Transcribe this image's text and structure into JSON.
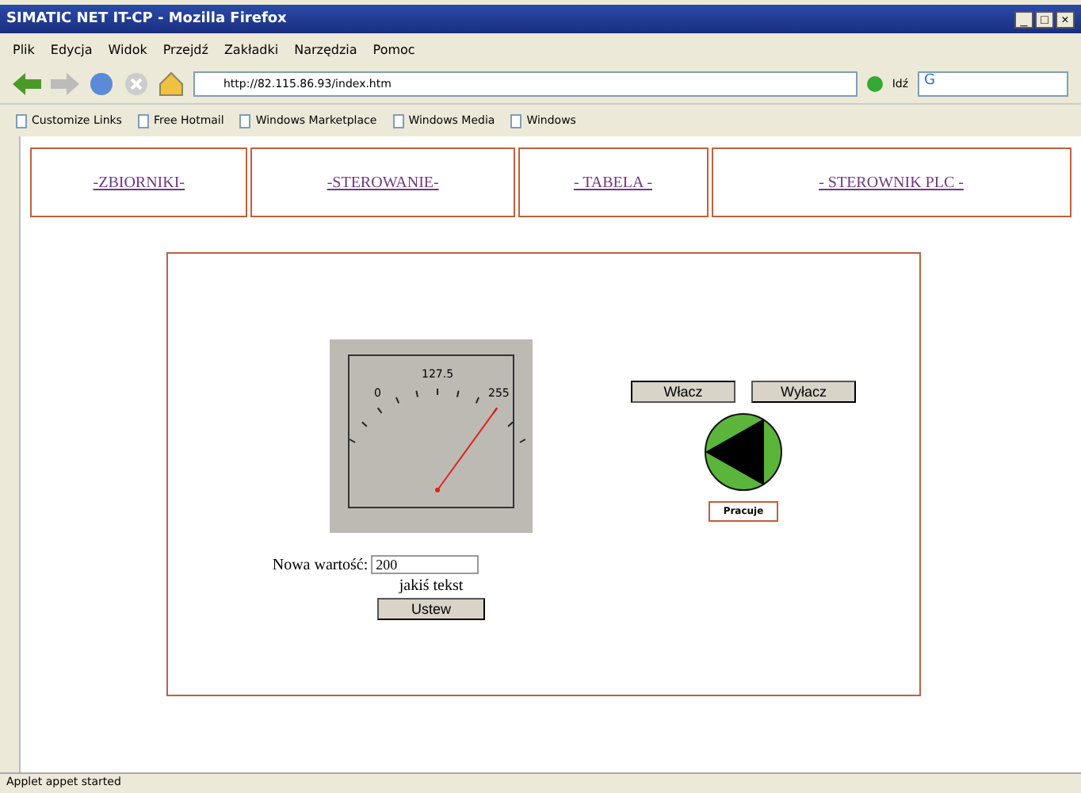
{
  "window": {
    "title": "SIMATIC NET IT-CP - Mozilla Firefox",
    "controls": [
      "_",
      "□",
      "×"
    ]
  },
  "menu": [
    "Plik",
    "Edycja",
    "Widok",
    "Przejdź",
    "Zakładki",
    "Narzędzia",
    "Pomoc"
  ],
  "address": {
    "url": "http://82.115.86.93/index.htm",
    "go": "Idź",
    "search_value": "G"
  },
  "bookmarks": [
    "Customize Links",
    "Free Hotmail",
    "Windows Marketplace",
    "Windows Media",
    "Windows"
  ],
  "nav": [
    "-ZBIORNIKI-",
    "-STEROWANIE-",
    "- TABELA -",
    "- STEROWNIK PLC -"
  ],
  "gauge": {
    "min": "0",
    "mid": "127.5",
    "max": "255"
  },
  "form": {
    "label": "Nowa wartość:",
    "value": "200",
    "note": "jakiś tekst",
    "button": "Ustew"
  },
  "pump": {
    "buttons": [
      "Włacz",
      "Wyłacz"
    ],
    "running": true,
    "status": "Pracuje"
  },
  "status_bar": "Applet appet started"
}
